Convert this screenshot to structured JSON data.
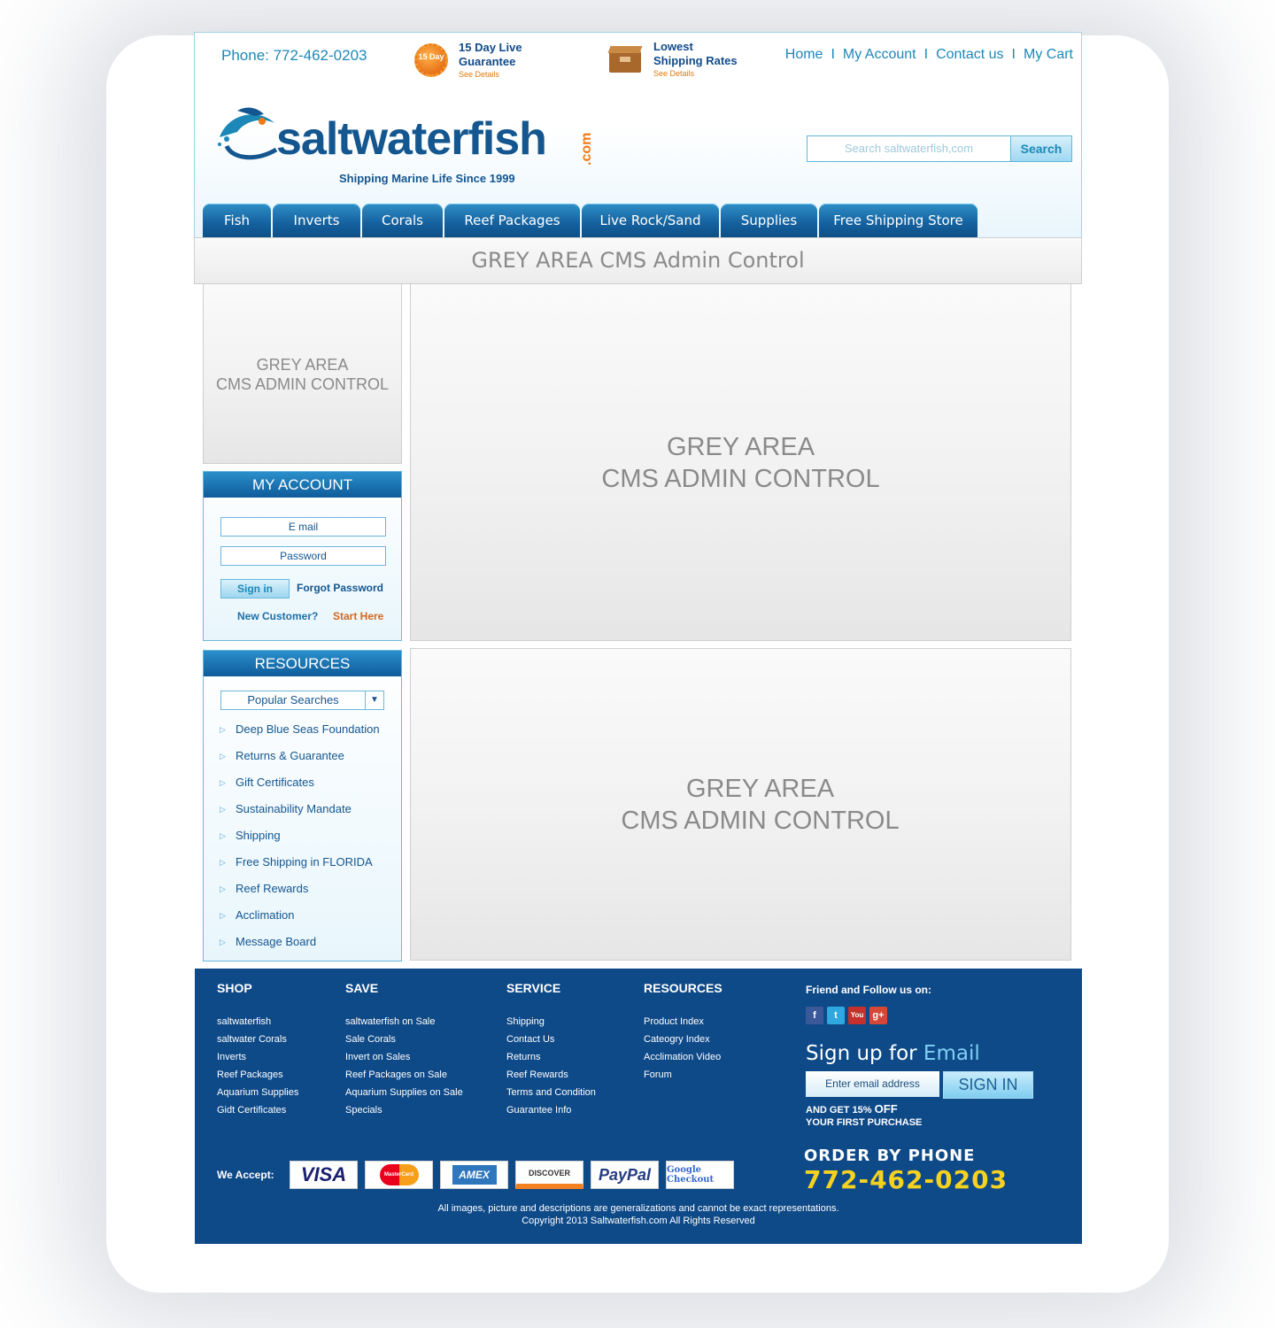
{
  "header": {
    "phone": "Phone: 772-462-0203",
    "guarantee": {
      "seal_text": "15 Day",
      "title_line1": "15 Day Live",
      "title_line2": "Guarantee",
      "sub": "See Details"
    },
    "shipping": {
      "title_line1": "Lowest",
      "title_line2": "Shipping Rates",
      "sub": "See Details"
    },
    "links": [
      "Home",
      "My Account",
      "Contact us",
      "My Cart"
    ],
    "separator": "I"
  },
  "logo": {
    "name": "saltwaterfish",
    "suffix": ".com",
    "tagline": "Shipping Marine Life Since 1999"
  },
  "search": {
    "placeholder": "Search saltwaterfish,com",
    "button": "Search"
  },
  "nav": {
    "tabs": [
      "Fish",
      "Inverts",
      "Corals",
      "Reef Packages",
      "Live Rock/Sand",
      "Supplies",
      "Free Shipping Store"
    ]
  },
  "banner": {
    "text": "GREY AREA CMS Admin Control"
  },
  "left_grey": {
    "line1": "GREY AREA",
    "line2": "CMS ADMIN CONTROL"
  },
  "main_grey_1": {
    "line1": "GREY AREA",
    "line2": "CMS ADMIN CONTROL"
  },
  "main_grey_2": {
    "line1": "GREY AREA",
    "line2": "CMS ADMIN CONTROL"
  },
  "account": {
    "title": "MY ACCOUNT",
    "email_placeholder": "E mail",
    "password_placeholder": "Password",
    "signin": "Sign in",
    "forgot": "Forgot Password",
    "new_customer": "New Customer?",
    "start_here": "Start Here"
  },
  "resources": {
    "title": "RESOURCES",
    "select_value": "Popular Searches",
    "items": [
      "Deep Blue Seas Foundation",
      "Returns & Guarantee",
      "Gift Certificates",
      "Sustainability Mandate",
      "Shipping",
      "Free Shipping in FLORIDA",
      "Reef Rewards",
      "Acclimation",
      "Message Board"
    ]
  },
  "footer": {
    "shop": {
      "title": "SHOP",
      "items": [
        "saltwaterfish",
        "saltwater Corals",
        "Inverts",
        "Reef Packages",
        "Aquarium Supplies",
        "Gidt Certificates"
      ]
    },
    "save": {
      "title": "SAVE",
      "items": [
        "saltwaterfish on Sale",
        "Sale Corals",
        "Invert on Sales",
        "Reef Packages on Sale",
        "Aquarium Supplies on Sale",
        "Specials"
      ]
    },
    "service": {
      "title": "SERVICE",
      "items": [
        "Shipping",
        "Contact Us",
        "Returns",
        "Reef Rewards",
        "Terms and Condition",
        "Guarantee Info"
      ]
    },
    "resources": {
      "title": "RESOURCES",
      "items": [
        "Product Index",
        "Cateogry Index",
        "Acclimation Video",
        "Forum"
      ]
    },
    "follow_title": "Friend and Follow us on:",
    "social": [
      "facebook-icon",
      "twitter-icon",
      "youtube-icon",
      "google-plus-icon"
    ],
    "signup_prefix": "Sign up for ",
    "signup_em": "Email",
    "email_placeholder": "Enter email address",
    "signin_button": "SIGN IN",
    "offer_line1_a": "AND GET 15% ",
    "offer_line1_b": "OFF",
    "offer_line2": "YOUR FIRST PURCHASE",
    "order_title": "ORDER BY PHONE",
    "order_number": "772-462-0203",
    "accept_label": "We Accept:",
    "cards": [
      "VISA",
      "MasterCard",
      "AMEX",
      "DISCOVER",
      "PayPal",
      "Google Checkout"
    ],
    "legal_line1": "All images, picture and descriptions are generalizations and cannot be exact representations.",
    "legal_line2": "Copyright 2013 Saltwaterfish.com  All Rights Reserved"
  },
  "colors": {
    "brand_blue": "#14568f",
    "accent_orange": "#f07a14",
    "footer_bg": "#0f4a88",
    "phone_yellow": "#f5d21f"
  }
}
